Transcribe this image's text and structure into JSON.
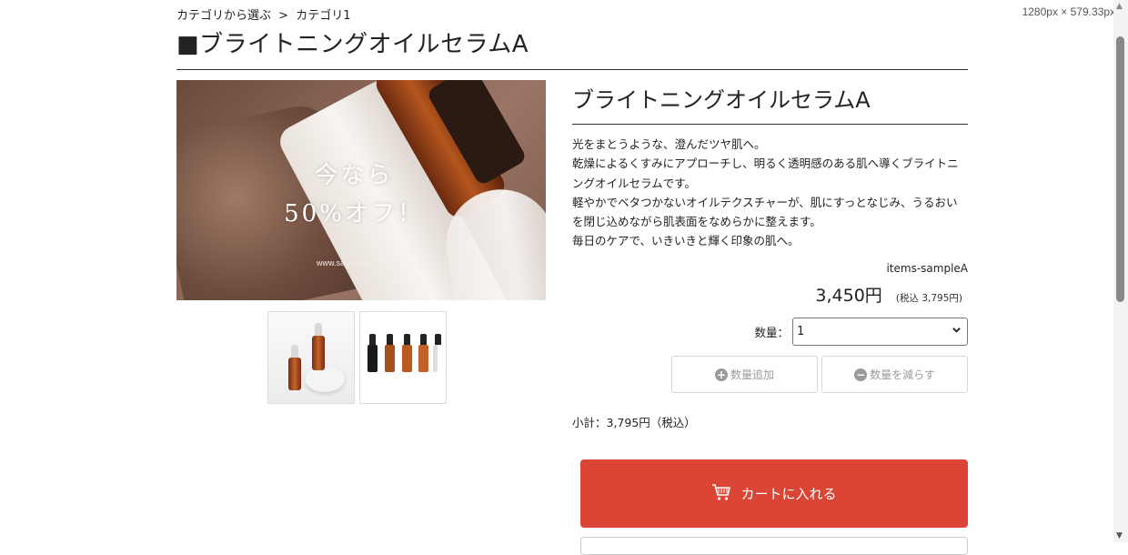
{
  "viewport_size_label": "1280px × 579.33px",
  "breadcrumb": {
    "items": [
      "カテゴリから選ぶ",
      ">",
      "カテゴリ1"
    ]
  },
  "page_title": "■ブライトニングオイルセラムA",
  "main_image": {
    "promo_line1": "今なら",
    "promo_line2": "50%オフ！",
    "url": "www.sampleshop.co.jp"
  },
  "product": {
    "name": "ブライトニングオイルセラムA",
    "description": [
      "光をまとうような、澄んだツヤ肌へ。",
      "乾燥によるくすみにアプローチし、明るく透明感のある肌へ導くブライトニングオイルセラムです。",
      "軽やかでベタつかないオイルテクスチャーが、肌にすっとなじみ、うるおいを閉じ込めながら肌表面をなめらかに整えます。",
      "毎日のケアで、いきいきと輝く印象の肌へ。"
    ],
    "item_code": "items-sampleA",
    "price": "3,450円",
    "tax_note": "(税込 3,795円)"
  },
  "quantity": {
    "label": "数量：",
    "selected": "1",
    "add_label": "数量追加",
    "reduce_label": "数量を減らす"
  },
  "subtotal": "小計：3,795円（税込）",
  "cart_button_label": "カートに入れる",
  "colors": {
    "cart_button": "#db4535",
    "text": "#222222",
    "disabled_text": "#9a9a9a"
  }
}
